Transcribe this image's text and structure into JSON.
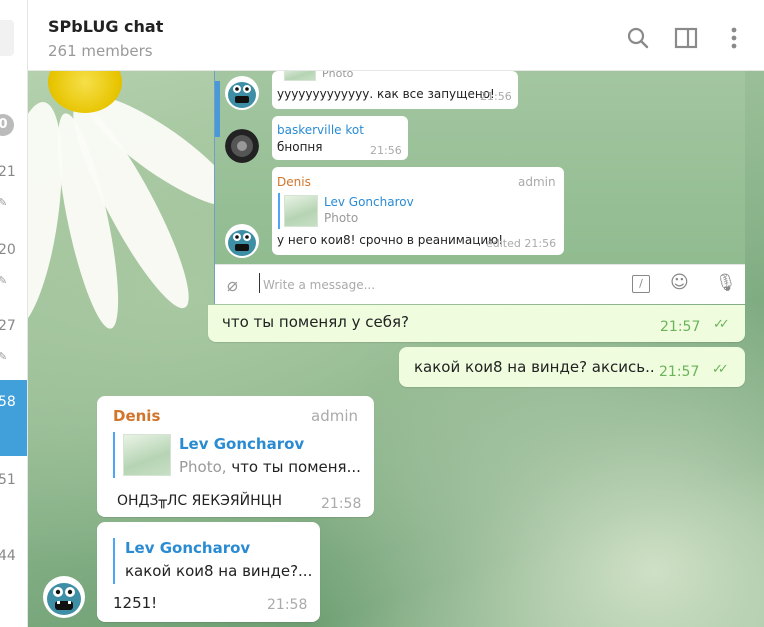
{
  "header": {
    "title": "SPbLUG chat",
    "subtitle": "261 members",
    "icons": [
      "search-icon",
      "sidebar-toggle-icon",
      "more-vertical-icon"
    ]
  },
  "left_strip": {
    "badge": "0",
    "items": [
      {
        "num": "21"
      },
      {
        "num": "20"
      },
      {
        "num": "27"
      },
      {
        "num": "58"
      },
      {
        "num": "51"
      },
      {
        "num": "44"
      }
    ]
  },
  "embedded": {
    "msg1": {
      "reply_sub": "Photo",
      "text": "ууууууууууууу. как все запущено!",
      "time": "21:56"
    },
    "msg2": {
      "author": "baskerville kot",
      "text": "бнопня",
      "time": "21:56"
    },
    "msg3": {
      "author": "Denis",
      "role": "admin",
      "reply_name": "Lev Goncharov",
      "reply_sub": "Photo",
      "text": "у него кои8! срочно в реанимацию!",
      "time": "edited 21:56"
    },
    "input_placeholder": "Write a message..."
  },
  "messages": {
    "m1": {
      "text": "что ты поменял у себя?",
      "time": "21:57"
    },
    "m2": {
      "text": "какой кои8 на винде? аксись..",
      "time": "21:57"
    },
    "m3": {
      "author": "Denis",
      "role": "admin",
      "reply_name": "Lev Goncharov",
      "reply_sub": "Photo,",
      "reply_text": " что ты поменя...",
      "text": "ОНДЗ╥ЛС ЯЕКЭЯЙНЦН",
      "time": "21:58"
    },
    "m4": {
      "reply_name": "Lev Goncharov",
      "reply_text": "какой кои8 на винде?...",
      "text": "1251!",
      "time": "21:58"
    }
  },
  "colors": {
    "accent": "#419fd9",
    "outgoing": "#effdde",
    "author": "#d2752c",
    "reply": "#2a8bd3"
  }
}
